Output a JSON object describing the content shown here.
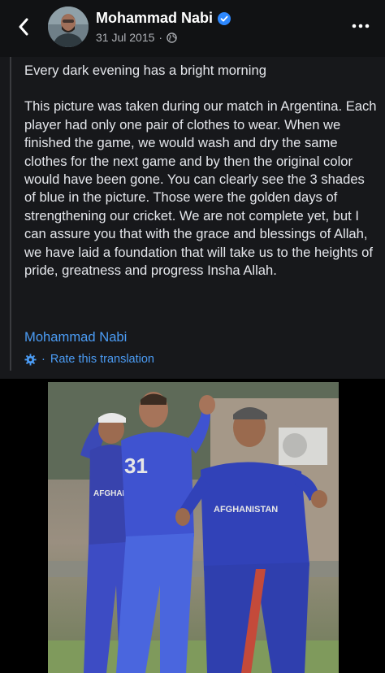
{
  "header": {
    "author_name": "Mohammad Nabi",
    "date": "31 Jul 2015",
    "separator": "·",
    "icons": {
      "back": "chevron-left-icon",
      "verified": "verified-badge-icon",
      "privacy": "globe-icon",
      "more": "more-horizontal-icon"
    }
  },
  "post": {
    "first_line": "Every dark evening has a bright morning",
    "body": "This picture was taken during our match in Argentina. Each player had only one pair of clothes to wear. When we finished the game, we would wash and dry the same clothes for the next game and by then the original color would have been gone. You can clearly see the 3 shades of blue in the picture. Those were the golden days of strengthening our cricket. We are not complete yet, but I can assure you that with the grace and blessings of Allah, we have laid a foundation that will take us to the heights of pride, greatness and progress Insha Allah.",
    "author_link": "Mohammad Nabi",
    "translation": {
      "separator": "·",
      "label": "Rate this translation",
      "icon": "gear-icon"
    }
  },
  "photo": {
    "jersey_text_1": "AFGHANISTAN",
    "jersey_text_2": "AFGHANISTAN"
  },
  "colors": {
    "link": "#4b9cf5",
    "text": "#e4e6eb",
    "muted": "#b0b3b8",
    "background": "#17181b",
    "verified": "#2d88ff"
  }
}
